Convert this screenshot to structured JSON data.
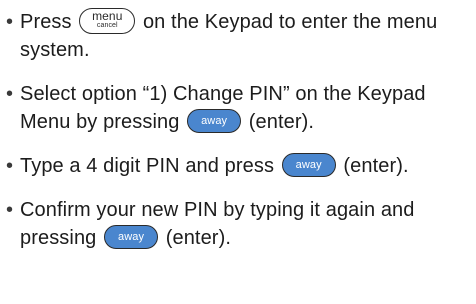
{
  "steps": [
    {
      "bullet": "•",
      "text_before": "Press ",
      "key": {
        "main": "menu",
        "sub": "cancel"
      },
      "text_after": " on the Keypad to enter the menu system."
    },
    {
      "bullet": "•",
      "text_before": "Select option “1) Change PIN” on the Keypad Menu by pressing ",
      "key": {
        "main": "away"
      },
      "text_after": " (enter)."
    },
    {
      "bullet": "•",
      "text_before": "Type a 4 digit PIN and press ",
      "key": {
        "main": "away"
      },
      "text_after": " (enter)."
    },
    {
      "bullet": "•",
      "text_before": "Confirm your new PIN by typing it again and pressing ",
      "key": {
        "main": "away"
      },
      "text_after": " (enter)."
    }
  ],
  "colors": {
    "text": "#1c1c1c",
    "away_key_fill": "#4a86ce",
    "key_outline": "#2a2a2a"
  }
}
